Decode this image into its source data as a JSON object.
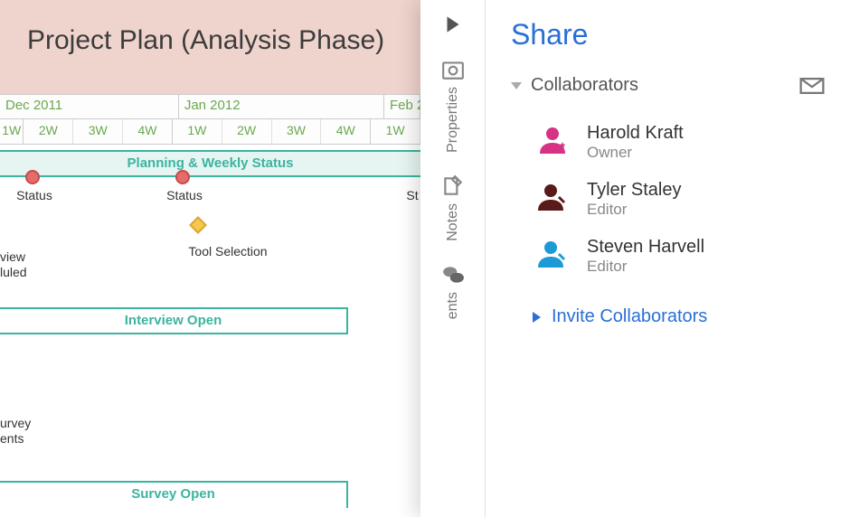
{
  "title": "Project Plan (Analysis Phase)",
  "timeline": {
    "months": [
      "Dec 2011",
      "Jan 2012",
      "Feb 2"
    ],
    "weeks": [
      "1W",
      "2W",
      "3W",
      "4W",
      "1W",
      "2W",
      "3W",
      "4W",
      "1W"
    ]
  },
  "bars": {
    "planning": "Planning & Weekly Status",
    "interview": "Interview Open",
    "survey": "Survey Open"
  },
  "milestones": {
    "status1": "Status",
    "status2": "Status",
    "status3": "St",
    "tool": "Tool Selection"
  },
  "edge": {
    "interview": "view\nluled",
    "survey": "urvey\nents"
  },
  "rail": {
    "properties": "Properties",
    "notes": "Notes",
    "comments": "ents"
  },
  "share": {
    "title": "Share",
    "section": "Collaborators",
    "invite": "Invite Collaborators",
    "collaborators": [
      {
        "name": "Harold Kraft",
        "role": "Owner",
        "color": "#d63384"
      },
      {
        "name": "Tyler Staley",
        "role": "Editor",
        "color": "#5a1a1a"
      },
      {
        "name": "Steven Harvell",
        "role": "Editor",
        "color": "#1b9ad6"
      }
    ]
  }
}
